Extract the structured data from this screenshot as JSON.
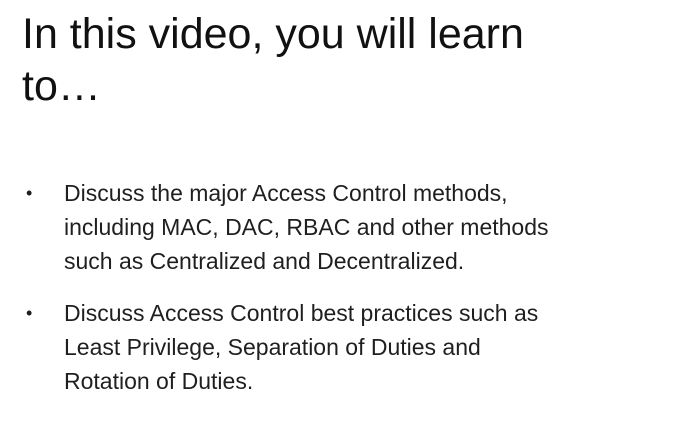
{
  "slide": {
    "title_lines": [
      "In this video, you will learn",
      "to…"
    ],
    "bullet_glyph": "•",
    "bullets": [
      {
        "lines": [
          "Discuss the major Access Control methods,",
          "including MAC, DAC, RBAC and other methods",
          "such as Centralized and Decentralized."
        ]
      },
      {
        "lines": [
          "Discuss Access Control best practices such as",
          "Least Privilege, Separation of Duties and",
          "Rotation of Duties."
        ]
      }
    ]
  }
}
